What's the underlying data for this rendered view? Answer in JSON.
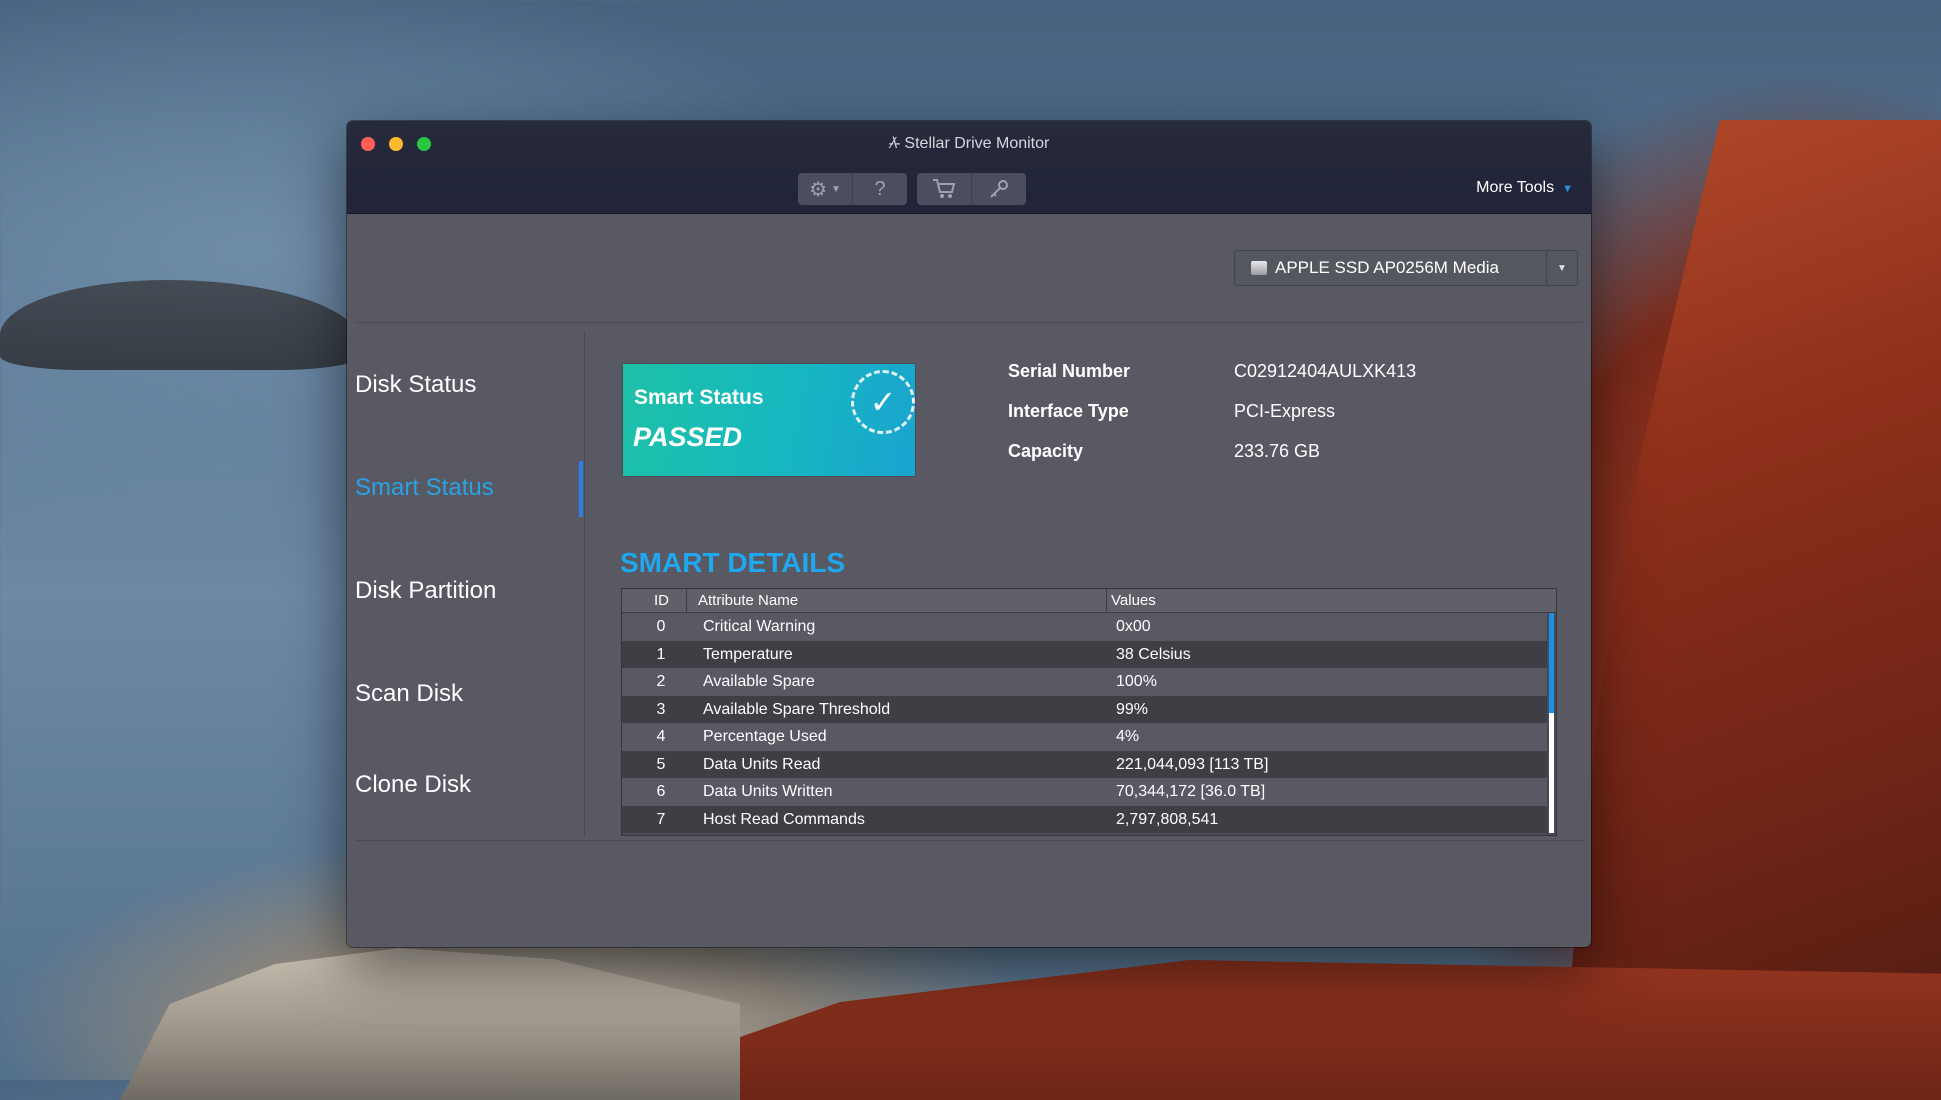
{
  "window": {
    "title": "Stellar Drive Monitor"
  },
  "toolbar": {
    "settings_icon": "gear-icon",
    "help_label": "?",
    "cart_icon": "cart-icon",
    "key_icon": "key-icon",
    "more_tools_label": "More Tools"
  },
  "disk_selector": {
    "selected": "APPLE SSD AP0256M Media"
  },
  "nav": {
    "items": [
      {
        "label": "Disk Status"
      },
      {
        "label": "Smart Status"
      },
      {
        "label": "Disk Partition"
      },
      {
        "label": "Scan Disk"
      },
      {
        "label": "Clone Disk"
      }
    ],
    "active": "Smart Status"
  },
  "smart": {
    "label": "Smart Status",
    "status": "PASSED"
  },
  "info": {
    "serial_label": "Serial Number",
    "serial_value": "C02912404AULXK413",
    "interface_label": "Interface Type",
    "interface_value": "PCI-Express",
    "capacity_label": "Capacity",
    "capacity_value": "233.76 GB"
  },
  "details": {
    "title": "SMART DETAILS",
    "columns": {
      "id": "ID",
      "name": "Attribute Name",
      "values": "Values"
    },
    "rows": [
      {
        "id": "0",
        "name": "Critical Warning",
        "value": "0x00"
      },
      {
        "id": "1",
        "name": "Temperature",
        "value": "38 Celsius"
      },
      {
        "id": "2",
        "name": "Available Spare",
        "value": "100%"
      },
      {
        "id": "3",
        "name": "Available Spare Threshold",
        "value": "99%"
      },
      {
        "id": "4",
        "name": "Percentage Used",
        "value": "4%"
      },
      {
        "id": "5",
        "name": "Data Units Read",
        "value": "221,044,093 [113 TB]"
      },
      {
        "id": "6",
        "name": "Data Units Written",
        "value": "70,344,172 [36.0 TB]"
      },
      {
        "id": "7",
        "name": "Host Read Commands",
        "value": "2,797,808,541"
      }
    ]
  },
  "colors": {
    "accent": "#1fa7ef",
    "card_start": "#1ec1a7",
    "card_end": "#1aa4d0"
  }
}
